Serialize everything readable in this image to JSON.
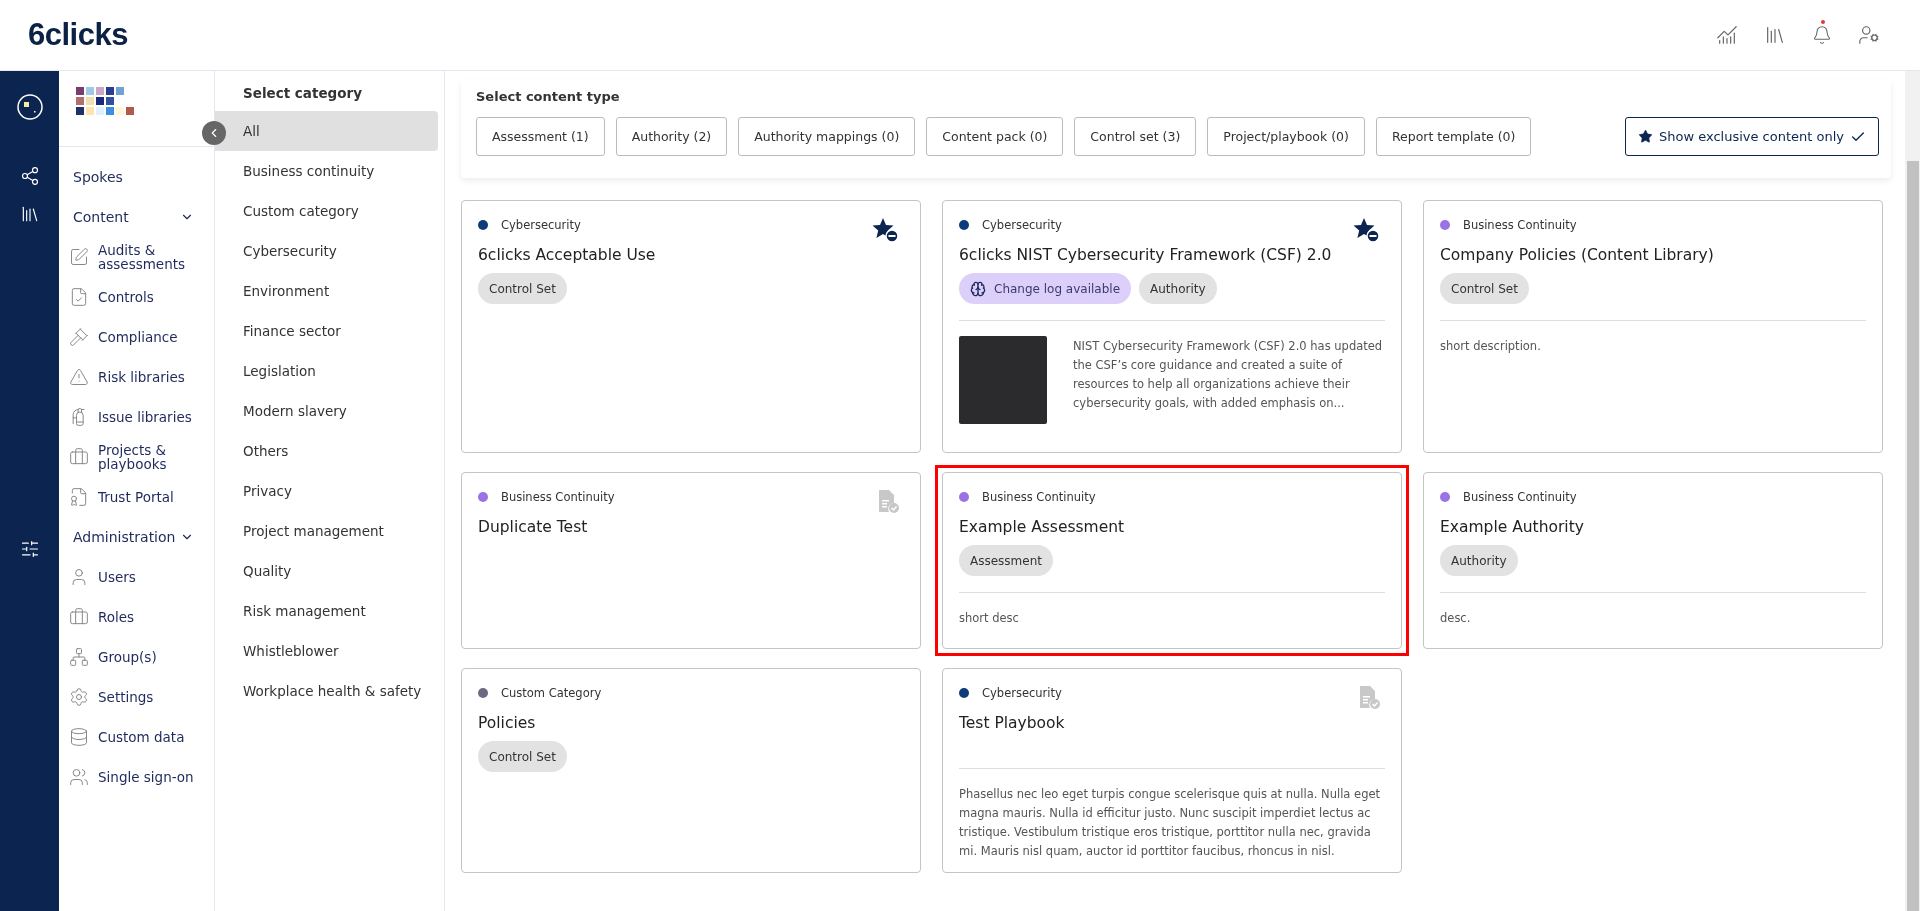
{
  "header": {
    "logo": "6clicks",
    "notification_dot": true
  },
  "nav": [
    {
      "kind": "link",
      "label": "Spokes"
    },
    {
      "kind": "section",
      "label": "Content",
      "expanded": true,
      "children": [
        "Audits & assessments",
        "Controls",
        "Compliance",
        "Risk libraries",
        "Issue libraries",
        "Projects & playbooks",
        "Trust Portal"
      ]
    },
    {
      "kind": "section",
      "label": "Administration",
      "expanded": true,
      "children": [
        "Users",
        "Roles",
        "Group(s)",
        "Settings",
        "Custom data",
        "Single sign-on"
      ]
    }
  ],
  "categories": {
    "title": "Select category",
    "items": [
      {
        "label": "All",
        "selected": true
      },
      {
        "label": "Business continuity",
        "selected": false
      },
      {
        "label": "Custom category",
        "selected": false
      },
      {
        "label": "Cybersecurity",
        "selected": false
      },
      {
        "label": "Environment",
        "selected": false
      },
      {
        "label": "Finance sector",
        "selected": false
      },
      {
        "label": "Legislation",
        "selected": false
      },
      {
        "label": "Modern slavery",
        "selected": false
      },
      {
        "label": "Others",
        "selected": false
      },
      {
        "label": "Privacy",
        "selected": false
      },
      {
        "label": "Project management",
        "selected": false
      },
      {
        "label": "Quality",
        "selected": false
      },
      {
        "label": "Risk management",
        "selected": false
      },
      {
        "label": "Whistleblower",
        "selected": false
      },
      {
        "label": "Workplace health & safety",
        "selected": false
      }
    ]
  },
  "content_types": {
    "title": "Select content type",
    "items": [
      {
        "label": "Assessment (1)",
        "selected": false
      },
      {
        "label": "Authority (2)",
        "selected": false
      },
      {
        "label": "Authority mappings (0)",
        "selected": false
      },
      {
        "label": "Content pack (0)",
        "selected": false
      },
      {
        "label": "Control set (3)",
        "selected": false
      },
      {
        "label": "Project/playbook (0)",
        "selected": false
      },
      {
        "label": "Report template (0)",
        "selected": false
      }
    ],
    "exclusive": {
      "label": "Show exclusive content only",
      "on": true
    }
  },
  "cards": [
    {
      "kind": "starred",
      "category": "Cybersecurity",
      "color": "#0d3c78",
      "title": "6clicks Acceptable Use",
      "tags": [
        {
          "kind": "type",
          "label": "Control Set"
        }
      ],
      "selected": false
    },
    {
      "kind": "starred",
      "category": "Cybersecurity",
      "color": "#0d3c78",
      "title": "6clicks NIST Cybersecurity Framework (CSF) 2.0",
      "tags": [
        {
          "kind": "changelog",
          "label": "Change log available"
        },
        {
          "kind": "type",
          "label": "Authority"
        }
      ],
      "thumbnail": true,
      "description": "NIST Cybersecurity Framework (CSF) 2.0 has updated the CSF’s core guidance and created a suite of resources to help all organizations achieve their cybersecurity goals, with added emphasis on...",
      "selected": false
    },
    {
      "kind": "plain",
      "category": "Business Continuity",
      "color": "#9b72e3",
      "title": "Company Policies (Content Library)",
      "tags": [
        {
          "kind": "type",
          "label": "Control Set"
        }
      ],
      "description": "short description.",
      "selected": false
    },
    {
      "kind": "document",
      "category": "Business Continuity",
      "color": "#9b72e3",
      "title": "Duplicate Test",
      "selected": false
    },
    {
      "kind": "plain",
      "category": "Business Continuity",
      "color": "#9b72e3",
      "title": "Example Assessment",
      "tags": [
        {
          "kind": "type",
          "label": "Assessment"
        }
      ],
      "description": "short desc",
      "selected": true
    },
    {
      "kind": "plain",
      "category": "Business Continuity",
      "color": "#9b72e3",
      "title": "Example Authority",
      "tags": [
        {
          "kind": "type",
          "label": "Authority"
        }
      ],
      "description": "desc.",
      "selected": false
    },
    {
      "kind": "plain",
      "category": "Custom Category",
      "color": "#6b6a80",
      "title": "Policies",
      "tags": [
        {
          "kind": "type",
          "label": "Control Set"
        }
      ],
      "selected": false
    },
    {
      "kind": "document",
      "category": "Cybersecurity",
      "color": "#0d3c78",
      "title": "Test Playbook",
      "description": "Phasellus nec leo eget turpis congue scelerisque quis at nulla. Nulla eget magna mauris. Nulla id efficitur justo. Nunc suscipit imperdiet lectus ac tristique. Vestibulum tristique eros tristique, porttitor nulla nec, gravida mi. Mauris nisl quam, auctor id porttitor faucibus, rhoncus in nisl.",
      "selected": false
    }
  ]
}
